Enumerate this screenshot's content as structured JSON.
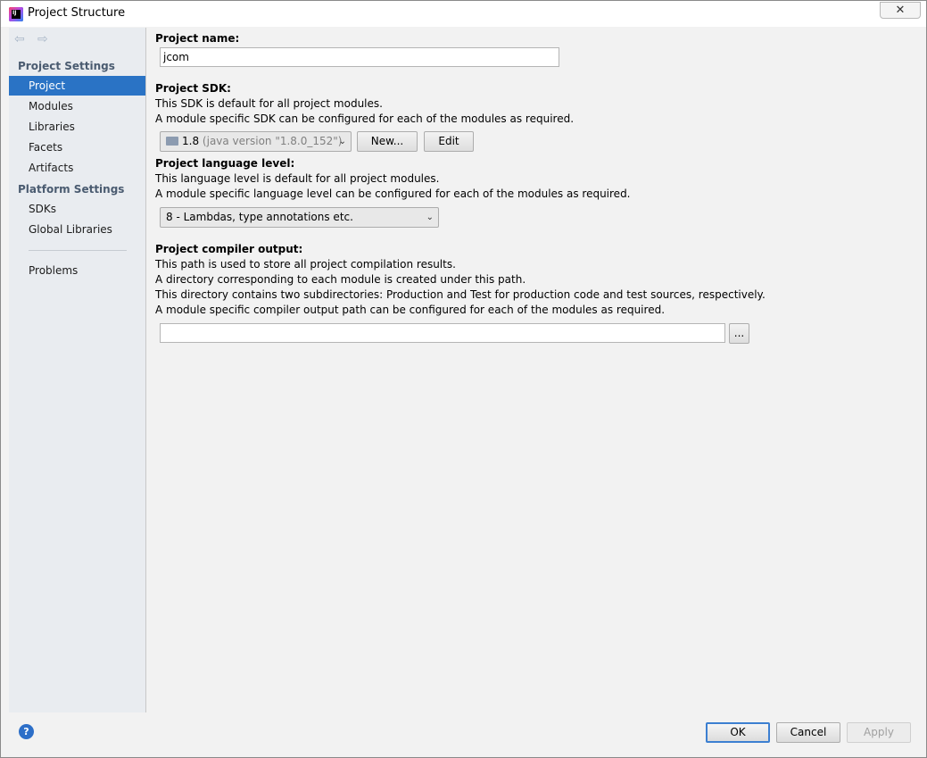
{
  "window": {
    "title": "Project Structure",
    "close_glyph": "✕"
  },
  "icons": {
    "app": "intellij-idea-icon",
    "back": "back-arrow-icon",
    "forward": "forward-arrow-icon",
    "help": "help-icon"
  },
  "sidebar": {
    "back_glyph": "⇦",
    "forward_glyph": "⇨",
    "project_settings_header": "Project Settings",
    "project_settings_items": [
      "Project",
      "Modules",
      "Libraries",
      "Facets",
      "Artifacts"
    ],
    "platform_settings_header": "Platform Settings",
    "platform_settings_items": [
      "SDKs",
      "Global Libraries"
    ],
    "problems_label": "Problems",
    "selected": "Project"
  },
  "project": {
    "name_label": "Project name:",
    "name_value": "jcom",
    "sdk_label": "Project SDK:",
    "sdk_desc_1": "This SDK is default for all project modules.",
    "sdk_desc_2": "A module specific SDK can be configured for each of the modules as required.",
    "sdk_value_version": "1.8",
    "sdk_value_detail": "(java version \"1.8.0_152\")",
    "sdk_new_button": "New...",
    "sdk_edit_button": "Edit",
    "language_label": "Project language level:",
    "language_desc_1": "This language level is default for all project modules.",
    "language_desc_2": "A module specific language level can be configured for each of the modules as required.",
    "language_value": "8 - Lambdas, type annotations etc.",
    "compiler_label": "Project compiler output:",
    "compiler_desc_1": "This path is used to store all project compilation results.",
    "compiler_desc_2": "A directory corresponding to each module is created under this path.",
    "compiler_desc_3": "This directory contains two subdirectories: Production and Test for production code and test sources, respectively.",
    "compiler_desc_4": "A module specific compiler output path can be configured for each of the modules as required.",
    "compiler_value": "",
    "browse_button": "..."
  },
  "footer": {
    "help_glyph": "?",
    "ok_button": "OK",
    "cancel_button": "Cancel",
    "apply_button": "Apply"
  },
  "colors": {
    "selection": "#2a73c5",
    "sidebar_bg": "#e9ecf0",
    "panel_bg": "#f2f2f2",
    "header_text": "#4a5b70"
  }
}
